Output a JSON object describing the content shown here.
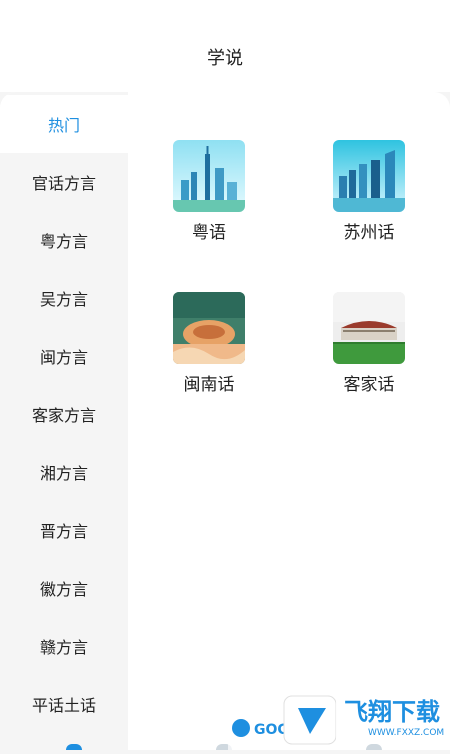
{
  "header": {
    "title": "学说"
  },
  "sidebar": {
    "items": [
      {
        "label": "热门",
        "active": true
      },
      {
        "label": "官话方言"
      },
      {
        "label": "粤方言"
      },
      {
        "label": "吴方言"
      },
      {
        "label": "闽方言"
      },
      {
        "label": "客家方言"
      },
      {
        "label": "湘方言"
      },
      {
        "label": "晋方言"
      },
      {
        "label": "徽方言"
      },
      {
        "label": "赣方言"
      },
      {
        "label": "平话土话"
      }
    ]
  },
  "grid": {
    "items": [
      {
        "label": "粤语",
        "image": "cantonese-city-skyline"
      },
      {
        "label": "苏州话",
        "image": "suzhou-skyline"
      },
      {
        "label": "闽南话",
        "image": "fujian-tulou"
      },
      {
        "label": "客家话",
        "image": "hakka-stadium"
      }
    ]
  },
  "watermark": {
    "left_text": "GOGO",
    "right_text": "飞翔下载",
    "url": "WWW.FXXZ.COM"
  },
  "colors": {
    "accent": "#1e8fe0",
    "sidebar_bg": "#f5f5f5",
    "content_bg": "#ffffff"
  }
}
